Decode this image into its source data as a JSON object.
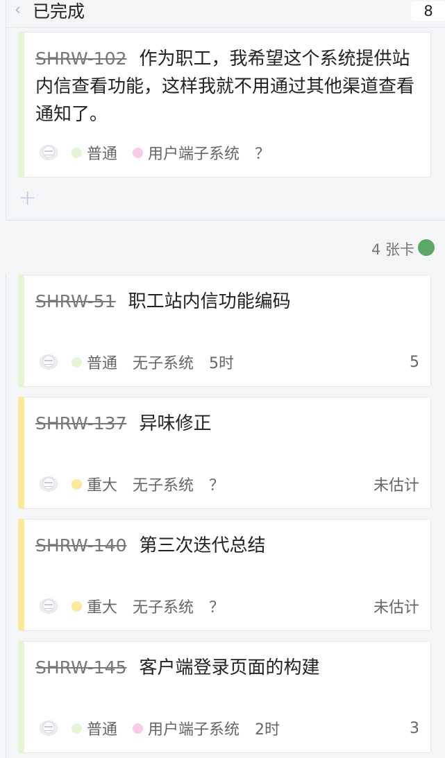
{
  "column": {
    "title": "已完成",
    "count": "8"
  },
  "top_card": {
    "id": "SHRW-102",
    "title": "作为职工，我希望这个系统提供站内信查看功能，这样我就不用通过其他渠道查看通知了。",
    "priority": "普通",
    "subsystem": "用户端子系统",
    "estimate": "？"
  },
  "group": {
    "cards_label": "4 张卡"
  },
  "cards": [
    {
      "id": "SHRW-51",
      "title": "职工站内信功能编码",
      "priority": "普通",
      "subsystem": "无子系统",
      "estimate": "5时",
      "points": "5"
    },
    {
      "id": "SHRW-137",
      "title": "异味修正",
      "priority": "重大",
      "subsystem": "无子系统",
      "estimate": "？",
      "points": "未估计"
    },
    {
      "id": "SHRW-140",
      "title": "第三次迭代总结",
      "priority": "重大",
      "subsystem": "无子系统",
      "estimate": "？",
      "points": "未估计"
    },
    {
      "id": "SHRW-145",
      "title": "客户端登录页面的构建",
      "priority": "普通",
      "subsystem": "用户端子系统",
      "estimate": "2时",
      "points": "3"
    }
  ],
  "colors": {
    "normal": "#e4f4d6",
    "major": "#fde99a",
    "subsystem": "#fbc9ea",
    "status": "#5aa864"
  },
  "icons": {
    "back": "chevron-left-icon",
    "add": "plus-icon",
    "avatar": "avatar-icon"
  }
}
